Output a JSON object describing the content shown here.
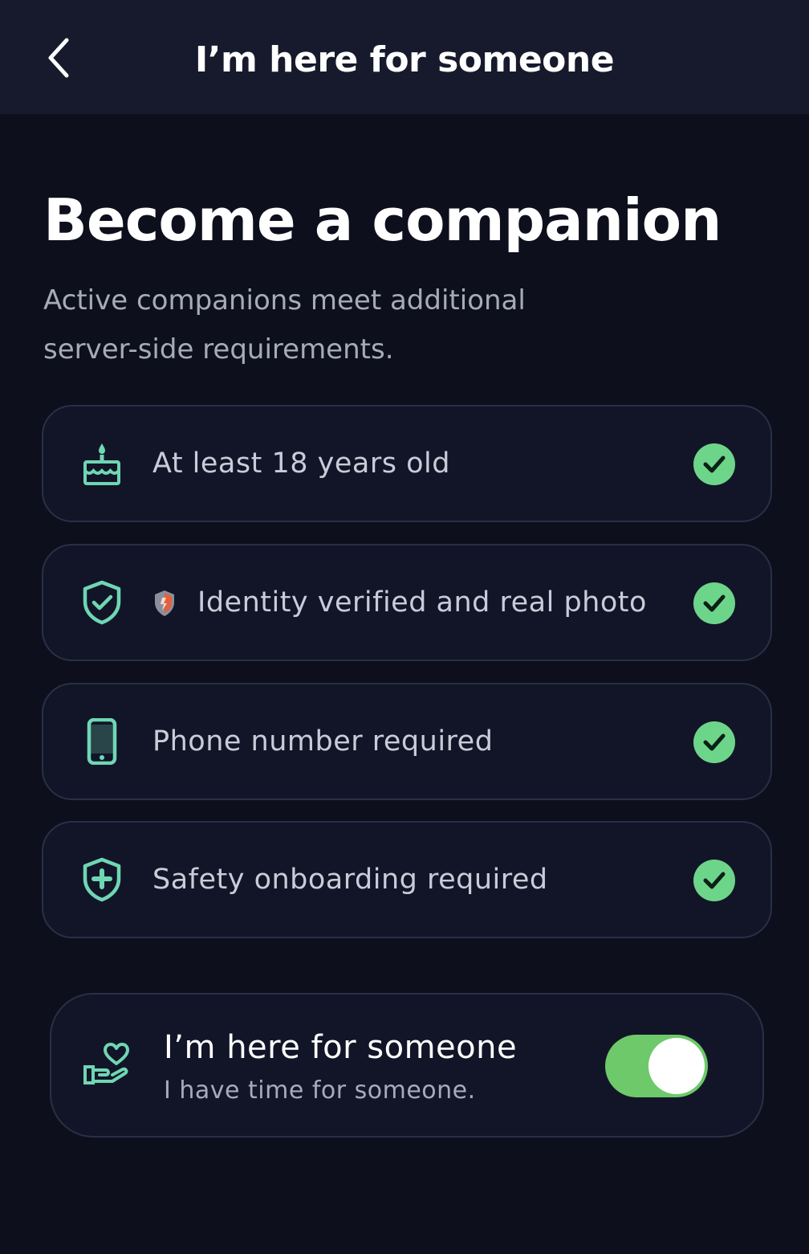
{
  "header": {
    "title": "I’m here for someone"
  },
  "main": {
    "title": "Become a companion",
    "subtitle": "Active companions meet additional server-side requirements."
  },
  "requirements": [
    {
      "label": "At least 18 years old",
      "icon": "birthday-cake-icon",
      "met": true
    },
    {
      "label": "Identity verified and real photo",
      "icon": "shield-check-icon",
      "met": true
    },
    {
      "label": "Phone number required",
      "icon": "smartphone-icon",
      "met": true
    },
    {
      "label": "Safety onboarding required",
      "icon": "shield-plus-icon",
      "met": true
    }
  ],
  "availability": {
    "title": "I’m here for someone",
    "subtitle": "I have time for someone.",
    "icon": "hand-heart-icon",
    "enabled": true
  },
  "colors": {
    "background": "#0d0f1c",
    "header": "#161a2c",
    "card": "#121527",
    "accent_icon": "#6fd6b4",
    "check": "#6dd58a",
    "toggle_on": "#6dc96a"
  }
}
